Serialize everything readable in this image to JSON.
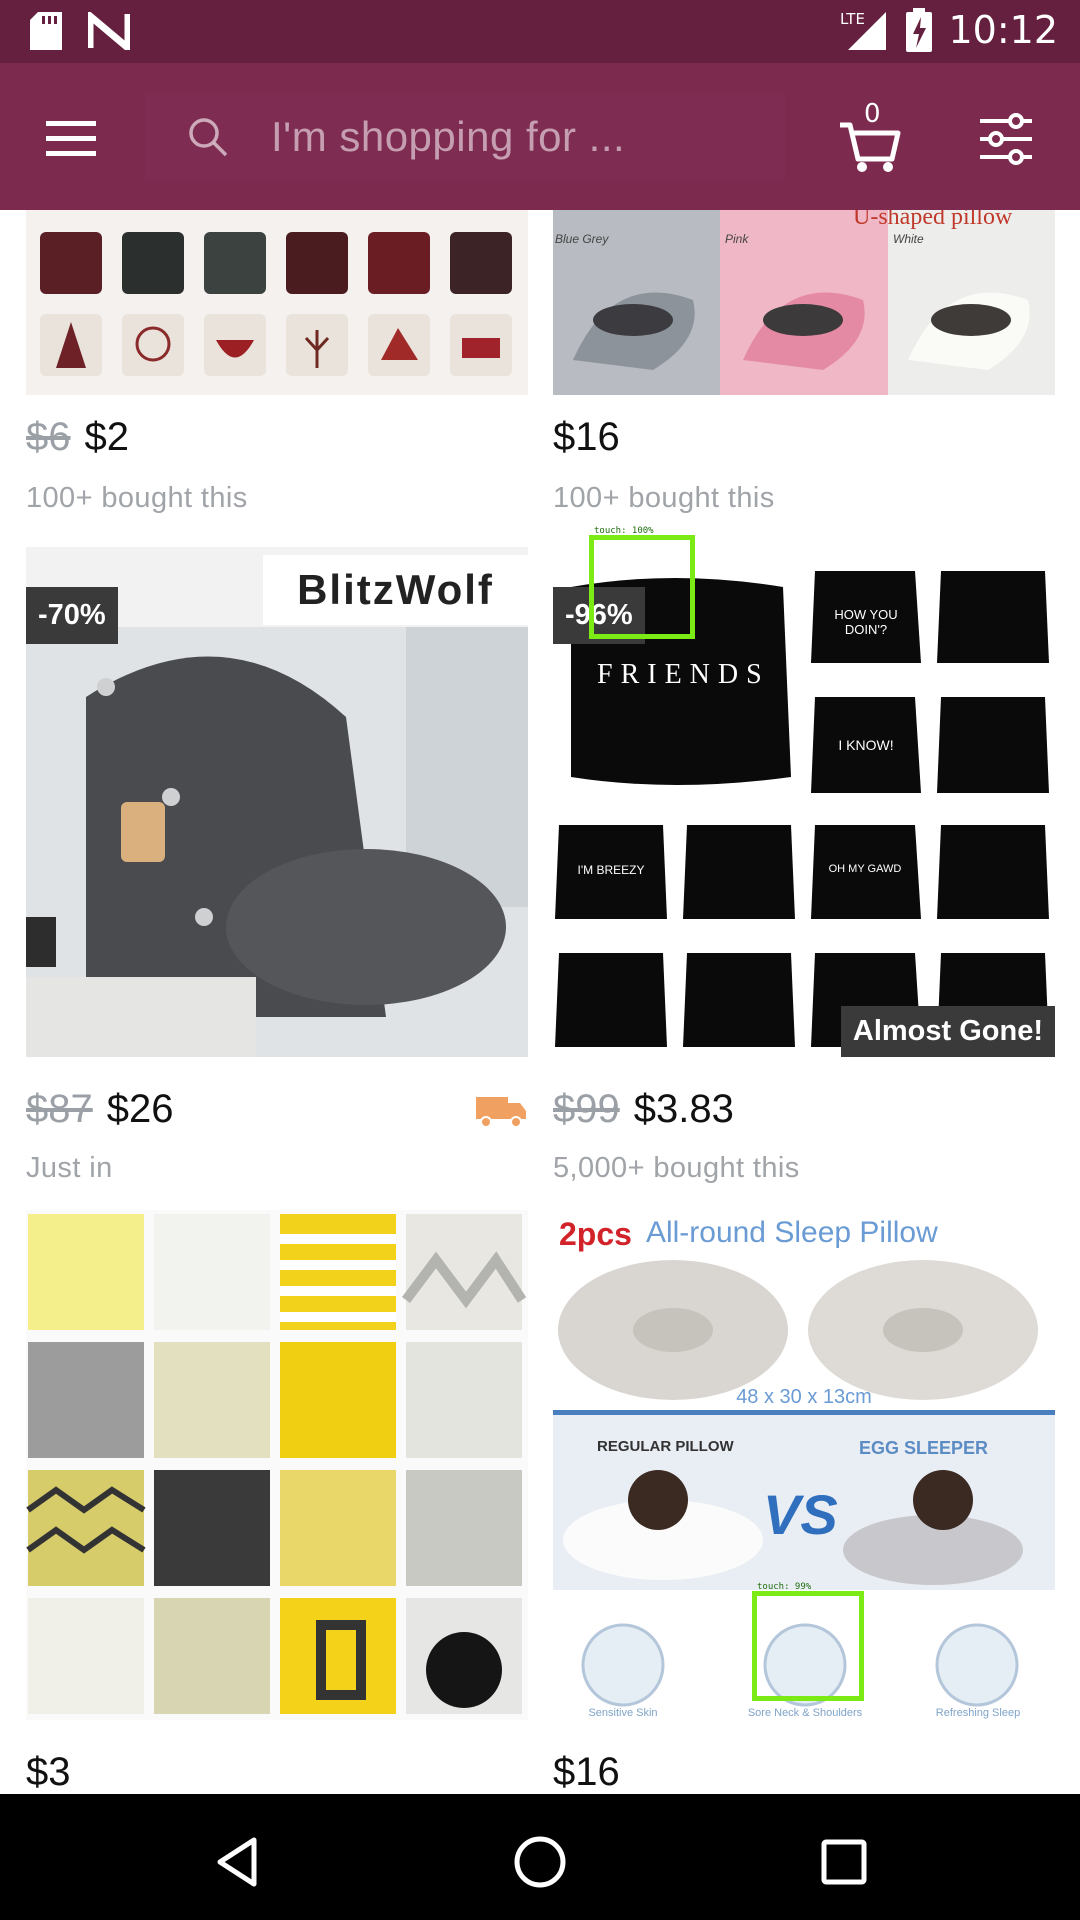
{
  "status_bar": {
    "time": "10:12",
    "network": "LTE",
    "icons": [
      "sd-card-icon",
      "n-notification-icon",
      "lte-signal-icon",
      "battery-charging-icon"
    ]
  },
  "app_bar": {
    "menu_icon": "hamburger-menu-icon",
    "search_placeholder": "I'm shopping for ...",
    "cart_count": "0",
    "filter_icon": "sliders-icon"
  },
  "products": [
    {
      "image": "christmas-pillow-covers",
      "old_price": "$6",
      "price": "$2",
      "meta": "100+ bought this"
    },
    {
      "image": "u-shaped-pillow",
      "image_text": "U-shaped pillow",
      "color_labels": [
        "Blue Grey",
        "Pink",
        "White"
      ],
      "old_price": "",
      "price": "$16",
      "meta": "100+ bought this"
    },
    {
      "image": "grey-backrest-cushion",
      "badge": "-70%",
      "brand": "BlitzWolf",
      "old_price": "$87",
      "price": "$26",
      "meta": "Just in",
      "shipping_icon": "truck-icon"
    },
    {
      "image": "friends-quote-pillows",
      "badge": "-96%",
      "overlay": "Almost Gone!",
      "pillow_texts": [
        "FRIENDS",
        "HOW YOU DOIN'?",
        "I KNOW!",
        "I'M BREEZY",
        "OH MY GAWD"
      ],
      "old_price": "$99",
      "price": "$3.83",
      "meta": "5,000+ bought this"
    },
    {
      "image": "yellow-geometric-pillows",
      "old_price": "",
      "price": "$3",
      "meta": ""
    },
    {
      "image": "egg-sleeper-pillow",
      "heading_red": "2pcs",
      "heading_blue": "All-round Sleep Pillow",
      "size_text": "48 x 30 x 13cm",
      "left_label": "REGULAR PILLOW",
      "vs_text": "VS",
      "right_label": "EGG SLEEPER",
      "features": [
        "Sensitive Skin",
        "Sore Neck & Shoulders",
        "Refreshing Sleep"
      ],
      "old_price": "",
      "price": "$16",
      "meta": ""
    }
  ],
  "touch_overlays": [
    {
      "label": "touch: 100%"
    },
    {
      "label": "touch: 99%"
    }
  ],
  "nav_bar": {
    "back": "back-triangle-icon",
    "home": "home-circle-icon",
    "recents": "recents-square-icon"
  },
  "colors": {
    "status_bar": "#64203e",
    "app_bar": "#7d2a4f",
    "touch_box": "#7bea15",
    "badge": "#3a3a3a"
  }
}
